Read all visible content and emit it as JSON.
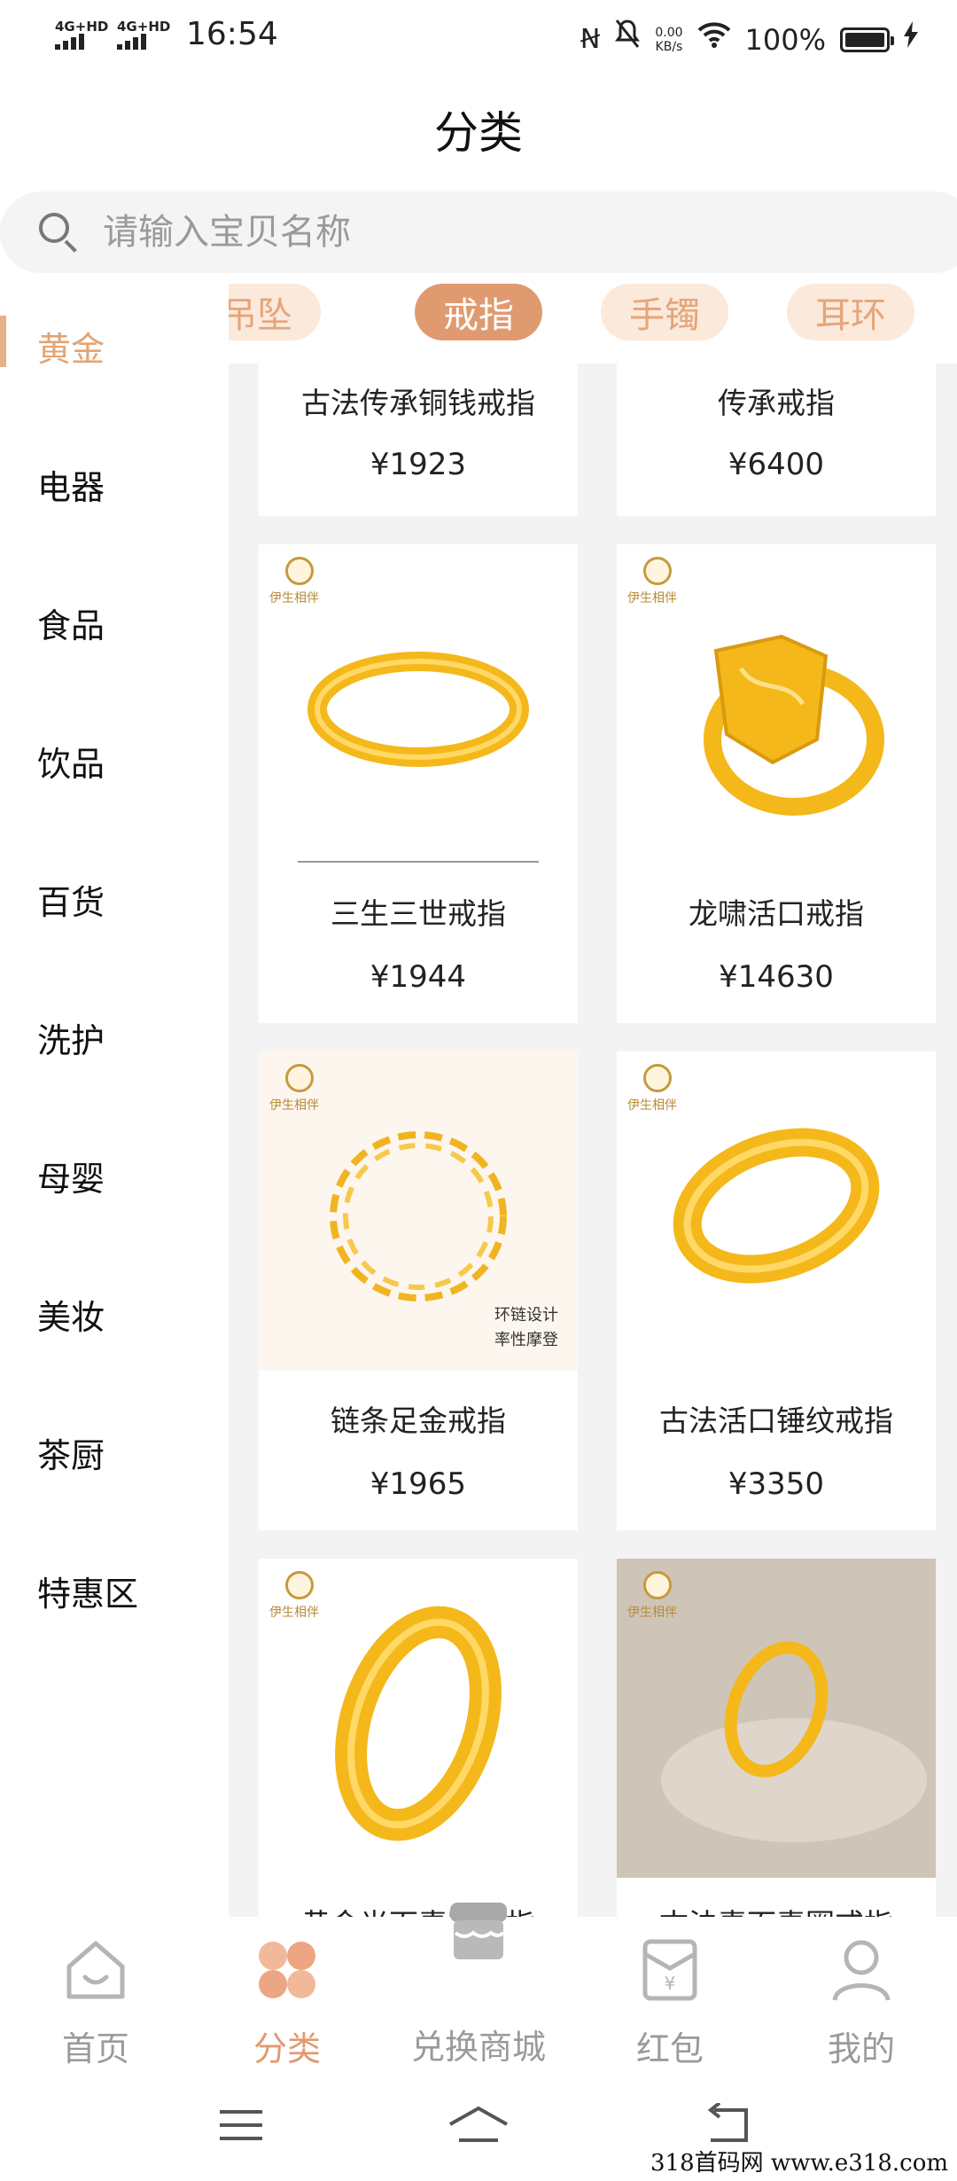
{
  "status_bar": {
    "net1": "4G+HD",
    "net2": "4G+HD",
    "time": "16:54",
    "speed_value": "0.00",
    "speed_unit": "KB/s",
    "battery": "100%"
  },
  "header": {
    "title": "分类"
  },
  "search": {
    "placeholder": "请输入宝贝名称"
  },
  "sidebar": {
    "items": [
      {
        "label": "黄金",
        "active": true
      },
      {
        "label": "电器"
      },
      {
        "label": "食品"
      },
      {
        "label": "饮品"
      },
      {
        "label": "百货"
      },
      {
        "label": "洗护"
      },
      {
        "label": "母婴"
      },
      {
        "label": "美妆"
      },
      {
        "label": "茶厨"
      },
      {
        "label": "特惠区"
      }
    ]
  },
  "sub_tabs": [
    {
      "label": "吊坠"
    },
    {
      "label": "戒指",
      "active": true
    },
    {
      "label": "手镯"
    },
    {
      "label": "耳环"
    }
  ],
  "products": [
    {
      "name": "古法传承铜钱戒指",
      "price": "¥1923"
    },
    {
      "name": "传承戒指",
      "price": "¥6400"
    },
    {
      "name": "三生三世戒指",
      "price": "¥1944"
    },
    {
      "name": "龙啸活口戒指",
      "price": "¥14630"
    },
    {
      "name": "链条足金戒指",
      "price": "¥1965"
    },
    {
      "name": "古法活口锤纹戒指",
      "price": "¥3350"
    },
    {
      "name": "黄金光面素圈戒指",
      "price": ""
    },
    {
      "name": "古法素面素圈戒指",
      "price": ""
    }
  ],
  "brand": {
    "name": "伊生相伴"
  },
  "slogan": {
    "line1": "环链设计",
    "line2": "率性摩登"
  },
  "bottom_nav": [
    {
      "label": "首页",
      "icon": "home-icon"
    },
    {
      "label": "分类",
      "icon": "category-icon",
      "active": true
    },
    {
      "label": "兑换商城",
      "icon": "store-icon"
    },
    {
      "label": "红包",
      "icon": "red-packet-icon"
    },
    {
      "label": "我的",
      "icon": "profile-icon"
    }
  ],
  "watermark": "318首码网  www.e318.com",
  "colors": {
    "accent": "#e09a70",
    "accent_light": "#fbe9db",
    "gold": "#f5b81c"
  }
}
